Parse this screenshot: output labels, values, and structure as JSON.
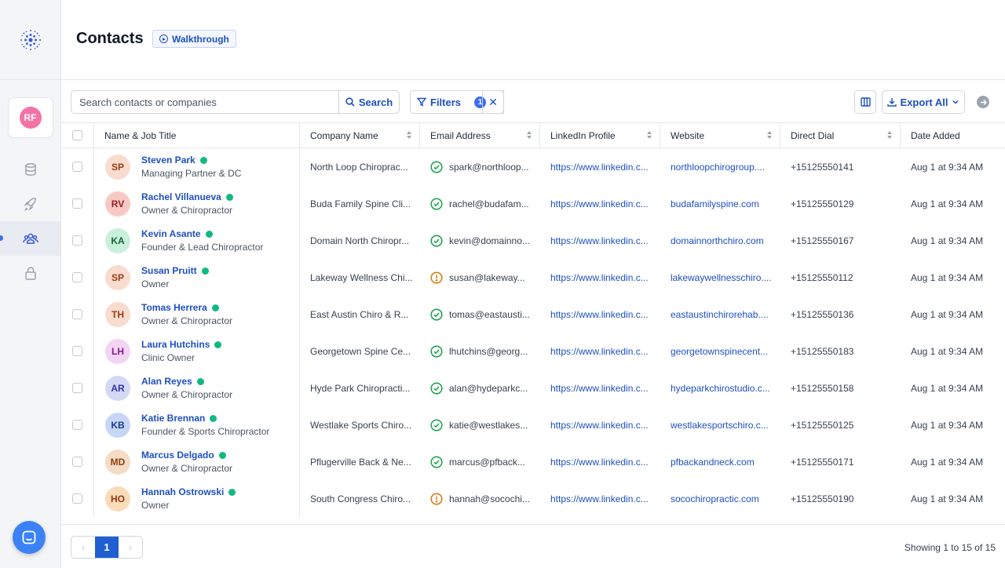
{
  "user_initials": "RF",
  "page": {
    "title": "Contacts",
    "walkthrough_label": "Walkthrough"
  },
  "toolbar": {
    "search_placeholder": "Search contacts or companies",
    "search_label": "Search",
    "filters_label": "Filters",
    "filters_count": "1",
    "export_label": "Export All"
  },
  "columns": [
    "Name & Job Title",
    "Company Name",
    "Email Address",
    "LinkedIn Profile",
    "Website",
    "Direct Dial",
    "Date Added"
  ],
  "rows": [
    {
      "initials": "SP",
      "avatar_bg": "#f8dccf",
      "avatar_fg": "#9a3b14",
      "name": "Steven Park",
      "title": "Managing Partner & DC",
      "company": "North Loop Chiroprac...",
      "email_status": "verified",
      "email": "spark@northloop...",
      "linkedin": "https://www.linkedin.c...",
      "website": "northloopchirogroup....",
      "dial": "+15125550141",
      "date": "Aug 1 at 9:34 AM"
    },
    {
      "initials": "RV",
      "avatar_bg": "#f8c9c4",
      "avatar_fg": "#9b1c1c",
      "name": "Rachel Villanueva",
      "title": "Owner & Chiropractor",
      "company": "Buda Family Spine Cli...",
      "email_status": "verified",
      "email": "rachel@budafam...",
      "linkedin": "https://www.linkedin.c...",
      "website": "budafamilyspine.com",
      "dial": "+15125550129",
      "date": "Aug 1 at 9:34 AM"
    },
    {
      "initials": "KA",
      "avatar_bg": "#c9f0dc",
      "avatar_fg": "#166534",
      "name": "Kevin Asante",
      "title": "Founder & Lead Chiropractor",
      "company": "Domain North Chiropr...",
      "email_status": "verified",
      "email": "kevin@domainno...",
      "linkedin": "https://www.linkedin.c...",
      "website": "domainnorthchiro.com",
      "dial": "+15125550167",
      "date": "Aug 1 at 9:34 AM"
    },
    {
      "initials": "SP",
      "avatar_bg": "#f8dccf",
      "avatar_fg": "#9a3b14",
      "name": "Susan Pruitt",
      "title": "Owner",
      "company": "Lakeway Wellness Chi...",
      "email_status": "warning",
      "email": "susan@lakeway...",
      "linkedin": "https://www.linkedin.c...",
      "website": "lakewaywellnesschiro....",
      "dial": "+15125550112",
      "date": "Aug 1 at 9:34 AM"
    },
    {
      "initials": "TH",
      "avatar_bg": "#f8dccf",
      "avatar_fg": "#9a3b14",
      "name": "Tomas Herrera",
      "title": "Owner & Chiropractor",
      "company": "East Austin Chiro & R...",
      "email_status": "verified",
      "email": "tomas@eastausti...",
      "linkedin": "https://www.linkedin.c...",
      "website": "eastaustinchirorehab....",
      "dial": "+15125550136",
      "date": "Aug 1 at 9:34 AM"
    },
    {
      "initials": "LH",
      "avatar_bg": "#f3d4f3",
      "avatar_fg": "#86198f",
      "name": "Laura Hutchins",
      "title": "Clinic Owner",
      "company": "Georgetown Spine Ce...",
      "email_status": "verified",
      "email": "lhutchins@georg...",
      "linkedin": "https://www.linkedin.c...",
      "website": "georgetownspinecent...",
      "dial": "+15125550183",
      "date": "Aug 1 at 9:34 AM"
    },
    {
      "initials": "AR",
      "avatar_bg": "#d3d9f5",
      "avatar_fg": "#3730a3",
      "name": "Alan Reyes",
      "title": "Owner & Chiropractor",
      "company": "Hyde Park Chiropracti...",
      "email_status": "verified",
      "email": "alan@hydeparkc...",
      "linkedin": "https://www.linkedin.c...",
      "website": "hydeparkchirostudio.c...",
      "dial": "+15125550158",
      "date": "Aug 1 at 9:34 AM"
    },
    {
      "initials": "KB",
      "avatar_bg": "#c7d6f7",
      "avatar_fg": "#1e3a8a",
      "name": "Katie Brennan",
      "title": "Founder & Sports Chiropractor",
      "company": "Westlake Sports Chiro...",
      "email_status": "verified",
      "email": "katie@westlakes...",
      "linkedin": "https://www.linkedin.c...",
      "website": "westlakesportschiro.c...",
      "dial": "+15125550125",
      "date": "Aug 1 at 9:34 AM"
    },
    {
      "initials": "MD",
      "avatar_bg": "#f5dcc6",
      "avatar_fg": "#92400e",
      "name": "Marcus Delgado",
      "title": "Owner & Chiropractor",
      "company": "Pflugerville Back & Ne...",
      "email_status": "verified",
      "email": "marcus@pfback...",
      "linkedin": "https://www.linkedin.c...",
      "website": "pfbackandneck.com",
      "dial": "+15125550171",
      "date": "Aug 1 at 9:34 AM"
    },
    {
      "initials": "HO",
      "avatar_bg": "#fbdcb8",
      "avatar_fg": "#9a3412",
      "name": "Hannah Ostrowski",
      "title": "Owner",
      "company": "South Congress Chiro...",
      "email_status": "warning",
      "email": "hannah@socochi...",
      "linkedin": "https://www.linkedin.c...",
      "website": "socochiropractic.com",
      "dial": "+15125550190",
      "date": "Aug 1 at 9:34 AM"
    }
  ],
  "pagination": {
    "current_page": "1",
    "showing": "Showing 1 to 15 of 15"
  },
  "colors": {
    "accent": "#1e4fc4",
    "verified": "#16a34a",
    "warning": "#d97706",
    "online": "#10b981"
  }
}
